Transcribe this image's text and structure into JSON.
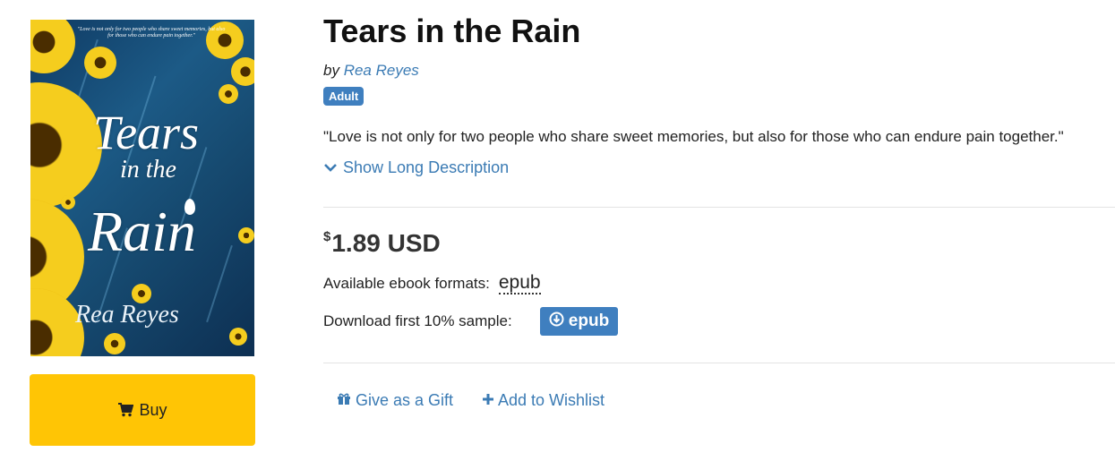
{
  "book": {
    "title": "Tears in the Rain",
    "by_prefix": "by",
    "author": "Rea Reyes",
    "audience_badge": "Adult",
    "short_description": "\"Love is not only for two people who share sweet memories, but also for those who can endure pain together.\"",
    "show_long_label": "Show Long Description"
  },
  "cover": {
    "quote": "\"Love is not only for two people who share sweet memories, but also for those who can endure pain together.\"",
    "title_line1": "Tears",
    "title_line2": "in the",
    "title_line3": "Rain",
    "author": "Rea Reyes"
  },
  "purchase": {
    "buy_label": "Buy",
    "currency_symbol": "$",
    "price": "1.89 USD",
    "formats_label": "Available ebook formats:",
    "format": "epub",
    "sample_label": "Download first 10% sample:",
    "sample_button": "epub"
  },
  "actions": {
    "gift_label": "Give as a Gift",
    "wishlist_label": "Add to Wishlist"
  },
  "colors": {
    "accent": "#3b7bb4",
    "buy_button": "#ffc505",
    "badge": "#3f7fbf"
  }
}
